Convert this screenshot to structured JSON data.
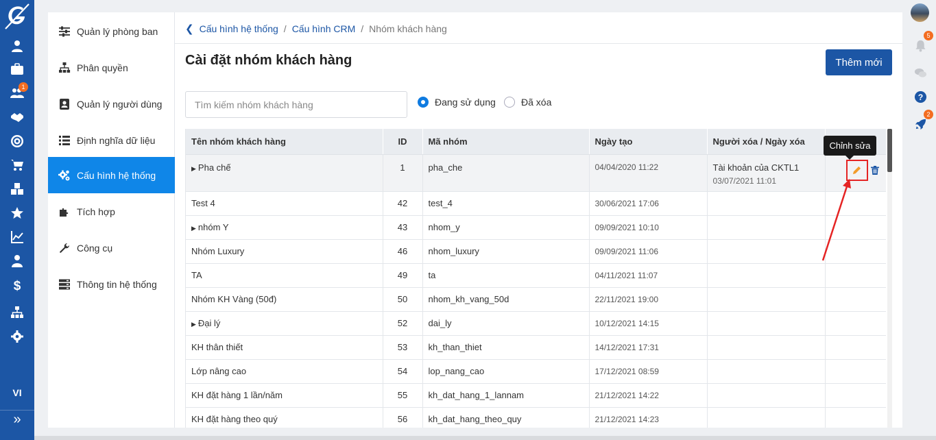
{
  "rail": {
    "lang": "VI",
    "expand": "»",
    "badge_users": "1",
    "icons": [
      "user-icon",
      "briefcase-icon",
      "users-icon",
      "handshake-icon",
      "target-icon",
      "cart-icon",
      "cubes-icon",
      "star-icon",
      "chart-line-icon",
      "contacts-icon",
      "dollar-icon",
      "sitemap-icon",
      "gear-icon"
    ]
  },
  "menu": {
    "items": [
      {
        "label": "Quản lý phòng ban",
        "icon": "sliders-icon"
      },
      {
        "label": "Phân quyền",
        "icon": "sitemap-icon"
      },
      {
        "label": "Quản lý người dùng",
        "icon": "user-book-icon"
      },
      {
        "label": "Định nghĩa dữ liệu",
        "icon": "list-icon"
      },
      {
        "label": "Cấu hình hệ thống",
        "icon": "cogs-icon",
        "active": true
      },
      {
        "label": "Tích hợp",
        "icon": "puzzle-icon"
      },
      {
        "label": "Công cụ",
        "icon": "wrench-icon"
      },
      {
        "label": "Thông tin hệ thống",
        "icon": "server-icon"
      }
    ]
  },
  "breadcrumb": {
    "items": [
      "Cấu hình hệ thống",
      "Cấu hình CRM",
      "Nhóm khách hàng"
    ],
    "sep": "/"
  },
  "page": {
    "title": "Cài đặt nhóm khách hàng",
    "add_button": "Thêm mới",
    "search_placeholder": "Tìm kiếm nhóm khách hàng",
    "filter_active": "Đang sử dụng",
    "filter_deleted": "Đã xóa"
  },
  "table": {
    "headers": [
      "Tên nhóm khách hàng",
      "ID",
      "Mã nhóm",
      "Ngày tạo",
      "Người xóa / Ngày xóa"
    ],
    "rows": [
      {
        "name": "Pha chế",
        "id": "1",
        "code": "pha_che",
        "created": "04/04/2020 11:22",
        "deleted_by": "Tài khoản của CKTL1",
        "deleted_at": "03/07/2021 11:01",
        "caret": true
      },
      {
        "name": "Test 4",
        "id": "42",
        "code": "test_4",
        "created": "30/06/2021 17:06",
        "deleted_by": "",
        "deleted_at": "",
        "caret": false
      },
      {
        "name": "nhóm Y",
        "id": "43",
        "code": "nhom_y",
        "created": "09/09/2021 10:10",
        "deleted_by": "",
        "deleted_at": "",
        "caret": true
      },
      {
        "name": "Nhóm Luxury",
        "id": "46",
        "code": "nhom_luxury",
        "created": "09/09/2021 11:06",
        "deleted_by": "",
        "deleted_at": "",
        "caret": false
      },
      {
        "name": "TA",
        "id": "49",
        "code": "ta",
        "created": "04/11/2021 11:07",
        "deleted_by": "",
        "deleted_at": "",
        "caret": false
      },
      {
        "name": "Nhóm KH Vàng (50đ)",
        "id": "50",
        "code": "nhom_kh_vang_50d",
        "created": "22/11/2021 19:00",
        "deleted_by": "",
        "deleted_at": "",
        "caret": false
      },
      {
        "name": "Đại lý",
        "id": "52",
        "code": "dai_ly",
        "created": "10/12/2021 14:15",
        "deleted_by": "",
        "deleted_at": "",
        "caret": true
      },
      {
        "name": "KH thân thiết",
        "id": "53",
        "code": "kh_than_thiet",
        "created": "14/12/2021 17:31",
        "deleted_by": "",
        "deleted_at": "",
        "caret": false
      },
      {
        "name": "Lớp nâng cao",
        "id": "54",
        "code": "lop_nang_cao",
        "created": "17/12/2021 08:59",
        "deleted_by": "",
        "deleted_at": "",
        "caret": false
      },
      {
        "name": "KH đặt hàng 1 lần/năm",
        "id": "55",
        "code": "kh_dat_hang_1_lannam",
        "created": "21/12/2021 14:22",
        "deleted_by": "",
        "deleted_at": "",
        "caret": false
      },
      {
        "name": "KH đặt hàng theo quý",
        "id": "56",
        "code": "kh_dat_hang_theo_quy",
        "created": "21/12/2021 14:23",
        "deleted_by": "",
        "deleted_at": "",
        "caret": false
      }
    ]
  },
  "tooltip": "Chỉnh sửa",
  "right_rail": {
    "notification_badge": "5",
    "rocket_badge": "2"
  },
  "colors": {
    "brand": "#1c56a5",
    "active": "#0f86e8",
    "badge": "#f36d21",
    "highlight": "#e52323"
  }
}
